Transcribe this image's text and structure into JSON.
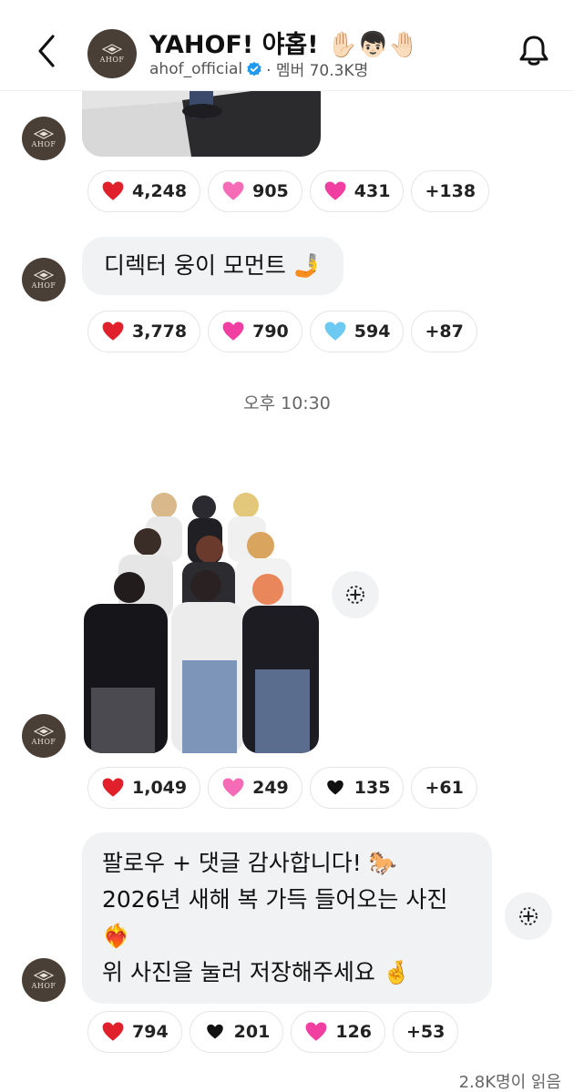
{
  "header": {
    "title": "YAHOF! 야홉! ✋🏻👦🏻🤚🏻",
    "handle": "ahof_official",
    "members": "· 멤버 70.3K명"
  },
  "avatar_logo_text": "AHOF",
  "messages": [
    {
      "type": "photo",
      "reactions": [
        {
          "emoji": "red-heart",
          "count": "4,248"
        },
        {
          "emoji": "sparkling-heart",
          "count": "905"
        },
        {
          "emoji": "pink-heart",
          "count": "431"
        },
        {
          "more": "+138"
        }
      ]
    },
    {
      "type": "text",
      "text": "디렉터 웅이 모먼트 🤳",
      "reactions": [
        {
          "emoji": "red-heart",
          "count": "3,778"
        },
        {
          "emoji": "pink-heart",
          "count": "790"
        },
        {
          "emoji": "light-blue-heart",
          "count": "594"
        },
        {
          "more": "+87"
        }
      ]
    },
    {
      "type": "photo",
      "reactions": [
        {
          "emoji": "red-heart",
          "count": "1,049"
        },
        {
          "emoji": "sparkling-heart",
          "count": "249"
        },
        {
          "emoji": "black-heart",
          "count": "135"
        },
        {
          "more": "+61"
        }
      ]
    },
    {
      "type": "text",
      "lines": [
        "팔로우 + 댓글 감사합니다! 🐎",
        "2026년 새해 복 가득 들어오는 사진",
        "❤️‍🔥",
        "위 사진을 눌러 저장해주세요 🤞"
      ],
      "reactions": [
        {
          "emoji": "red-heart",
          "count": "794"
        },
        {
          "emoji": "black-heart",
          "count": "201"
        },
        {
          "emoji": "pink-heart",
          "count": "126"
        },
        {
          "more": "+53"
        }
      ]
    }
  ],
  "timestamp": "오후 10:30",
  "read_count": "2.8K명이 읽음",
  "colors": {
    "red_heart": "#e0202a",
    "pink_heart": "#f03fa0",
    "sparkling_heart": "#f66bb6",
    "light_blue_heart": "#6cc9f2",
    "black_heart": "#111111",
    "verified": "#1d9bf0",
    "avatar_bg": "#4a3f36",
    "bubble_bg": "#f1f2f4"
  }
}
